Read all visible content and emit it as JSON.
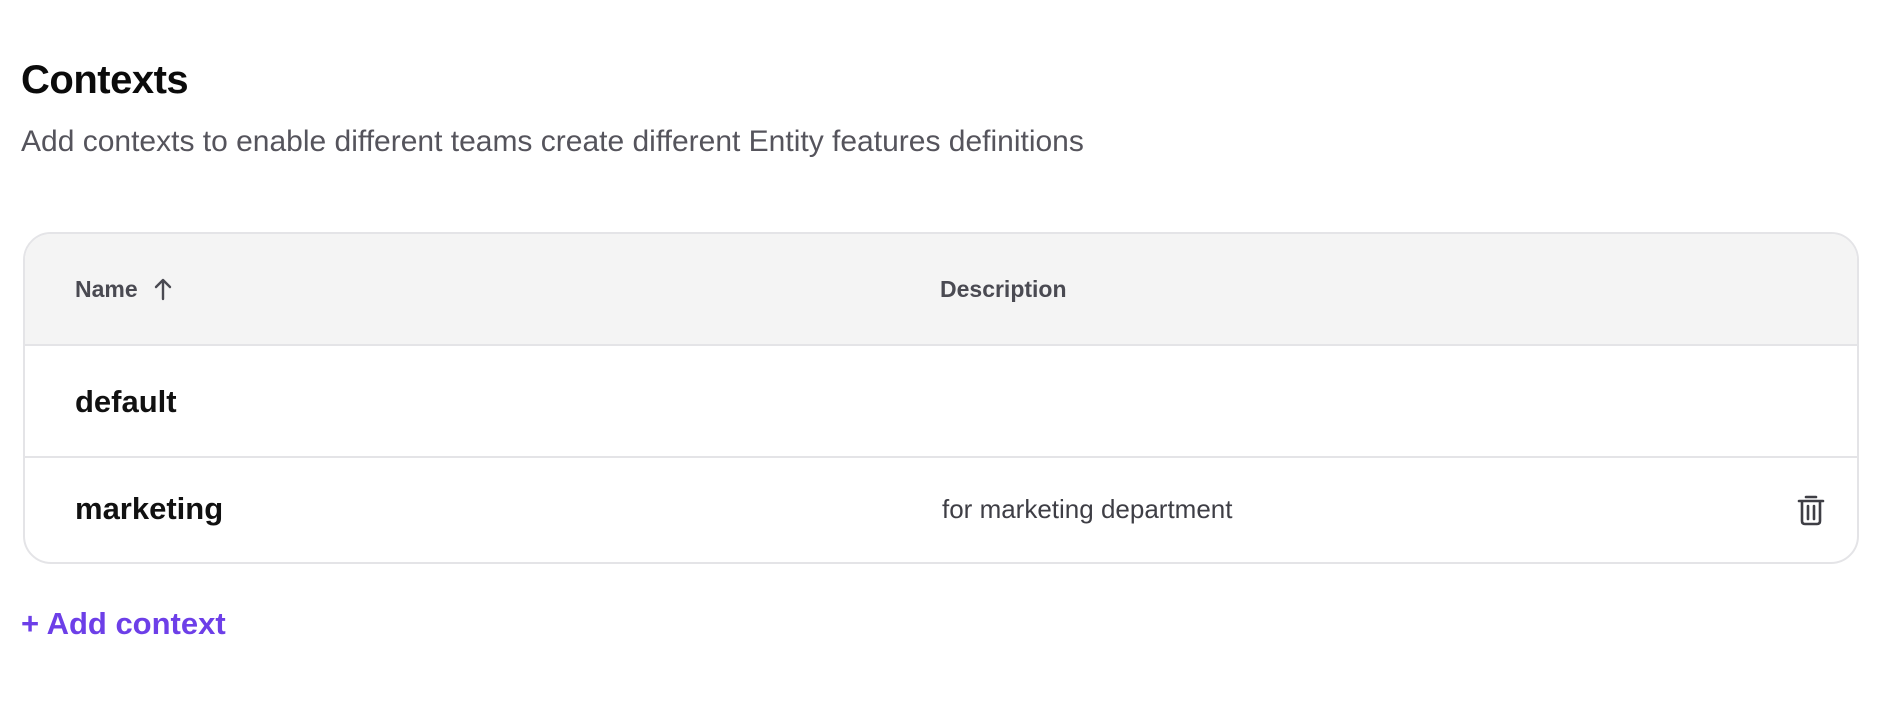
{
  "header": {
    "title": "Contexts",
    "subtitle": "Add contexts to enable different teams create different Entity features definitions"
  },
  "table": {
    "columns": {
      "name": {
        "label": "Name",
        "sort_icon": "arrow-up-icon",
        "sort_direction": "ascending"
      },
      "description": {
        "label": "Description"
      }
    },
    "rows": [
      {
        "name": "default",
        "description": ""
      },
      {
        "name": "marketing",
        "description": "for marketing department",
        "action_icon": "trash-icon"
      }
    ]
  },
  "footer": {
    "add_label": "+ Add context"
  },
  "colors": {
    "accent": "#6d3fe8",
    "header_bg": "#f4f4f4",
    "border": "#e4e4e7",
    "subtitle_text": "#55545c"
  }
}
